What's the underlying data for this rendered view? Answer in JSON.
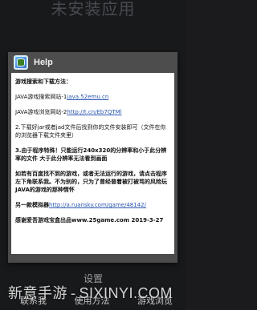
{
  "background": {
    "title": "未安装应用",
    "button_label": "设置",
    "tabs": [
      "联系我",
      "使用方法",
      "游戏浏览"
    ]
  },
  "dialog": {
    "title": "Help",
    "line1": "游戏搜索和下载方法：",
    "java_search_label": "JAVA游戏搜索网站-1",
    "java_search_link": "java.52emu.cn",
    "java_browse_label": "JAVA游戏浏览网站-2",
    "java_browse_link": "http://t.cn/Eb7QTMl",
    "line2": "2.下载好jar或者jad文件后找到你的文件安装即可（文件在你的浏览器下载文件夹里）",
    "line3": "3.由于程序特殊！只能运行240x320的分辨率和小于此分辨率的文件 大于此分辨率无法看到画面",
    "line4": "如若有百度找不到的游戏，或者无法运行的游戏，请点击程序左下角联系我。不为别的，只为了曾经普着被打被骂的风险玩JAVA的游戏的那种情怀",
    "emulator_label": "另一款模拟器",
    "emulator_link": "http://a.ruansky.com/game/48142/",
    "thanks": "感谢爱吾游戏宝盒出品www.25game.com 2019-3-27"
  },
  "watermark": {
    "left": "新意手游",
    "right": "SIXINYI.COM"
  },
  "colors": {
    "dialog_header": "#4d4d4d",
    "link": "#2a55b0",
    "screen_bg": "#18191b"
  }
}
